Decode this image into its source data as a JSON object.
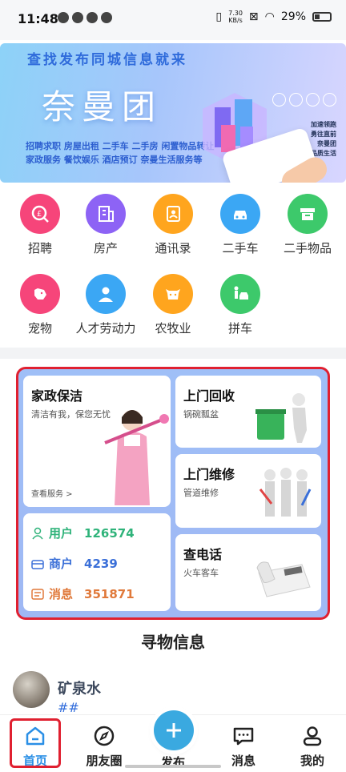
{
  "status_bar": {
    "time": "11:48",
    "net_speed": "7.30",
    "net_unit": "KB/s",
    "battery": "29%"
  },
  "banner": {
    "headline": "查找发布同城信息就来",
    "brand": "奈曼团",
    "services_line1": "招聘求职  房屋出租  二手车  二手房  闲置物品转让",
    "services_line2": "家政服务  餐饮娱乐  酒店预订  奈曼生活服务等",
    "side_line1": "加速领跑",
    "side_line2": "勇往直前",
    "side_line3": "奈曼团",
    "side_line4": "给你实惠品质生活"
  },
  "categories": [
    {
      "label": "招聘",
      "color": "#f6457a",
      "icon": "yuan-search-icon"
    },
    {
      "label": "房产",
      "color": "#8d63f5",
      "icon": "building-icon"
    },
    {
      "label": "通讯录",
      "color": "#ffa51e",
      "icon": "contacts-icon"
    },
    {
      "label": "二手车",
      "color": "#3ba7f4",
      "icon": "car-icon"
    },
    {
      "label": "二手物品",
      "color": "#3dc96b",
      "icon": "box-icon"
    },
    {
      "label": "宠物",
      "color": "#f6457a",
      "icon": "dog-icon"
    },
    {
      "label": "人才劳动力",
      "color": "#3ba7f4",
      "icon": "person-icon"
    },
    {
      "label": "农牧业",
      "color": "#ffa51e",
      "icon": "cow-icon"
    },
    {
      "label": "拼车",
      "color": "#3dc96b",
      "icon": "carpool-icon"
    }
  ],
  "services": {
    "housekeeping": {
      "title": "家政保洁",
      "subtitle": "清洁有我，保您无忧",
      "link": "查看服务 >"
    },
    "recycling": {
      "title": "上门回收",
      "subtitle": "锅碗瓢盆"
    },
    "repair": {
      "title": "上门维修",
      "subtitle": "管道维修"
    },
    "phone": {
      "title": "查电话",
      "subtitle": "火车客车"
    }
  },
  "stats": [
    {
      "label": "用户",
      "value": "126574",
      "color": "#2fb37a"
    },
    {
      "label": "商户",
      "value": "4239",
      "color": "#3a6fd8"
    },
    {
      "label": "消息",
      "value": "351871",
      "color": "#e0793a"
    }
  ],
  "lost_found": {
    "title": "寻物信息",
    "item_name": "矿泉水",
    "item_tag": "##"
  },
  "bottom_nav": [
    {
      "label": "首页"
    },
    {
      "label": "朋友圈"
    },
    {
      "label": "发布"
    },
    {
      "label": "消息"
    },
    {
      "label": "我的"
    }
  ]
}
